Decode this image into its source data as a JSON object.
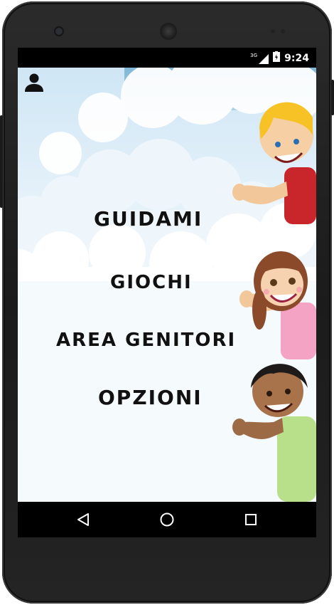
{
  "status_bar": {
    "network_label": "3G",
    "time": "9:24",
    "icons": [
      "signal-icon",
      "battery-icon"
    ]
  },
  "toolbar": {
    "profile_icon": "user-icon"
  },
  "menu": {
    "items": [
      {
        "label": "GUIDAMI"
      },
      {
        "label": "GIOCHI"
      },
      {
        "label": "AREA GENITORI"
      },
      {
        "label": "OPZIONI"
      }
    ]
  },
  "navigation_bar": {
    "icons": [
      "back-icon",
      "home-icon",
      "recents-icon"
    ]
  },
  "colors": {
    "sky_top": "#cfe6f5",
    "sky_bottom": "#f4f9fd",
    "menu_text": "#111111",
    "phone_body": "#222222"
  }
}
